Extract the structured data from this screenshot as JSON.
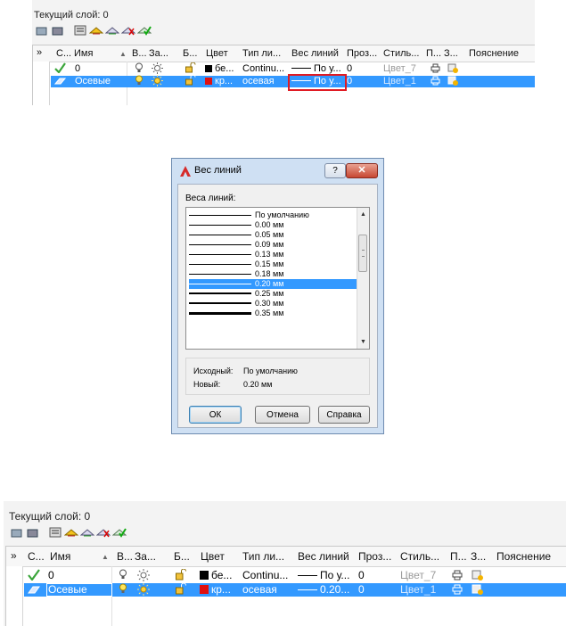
{
  "panel_before": {
    "current_layer": "Текущий слой: 0",
    "columns": [
      "С...",
      "Имя",
      "▲",
      "В...",
      "За...",
      "Б...",
      "Цвет",
      "Тип ли...",
      "Вес линий",
      "Проз...",
      "Стиль...",
      "П...",
      "З...",
      "Пояснение"
    ],
    "rows": [
      {
        "name": "0",
        "color": "бе...",
        "linetype": "Continu...",
        "lineweight": "По у...",
        "transparency": "0",
        "style": "Цвет_7",
        "swatch": "#000000",
        "selected": false
      },
      {
        "name": "Осевые",
        "color": "кр...",
        "linetype": "осевая",
        "lineweight": "По у...",
        "transparency": "0",
        "style": "Цвет_1",
        "swatch": "#e01010",
        "selected": true
      }
    ]
  },
  "dialog": {
    "title": "Вес линий",
    "help_glyph": "?",
    "close_glyph": "✕",
    "list_label": "Веса линий:",
    "items": [
      "По умолчанию",
      "0.00 мм",
      "0.05 мм",
      "0.09 мм",
      "0.13 мм",
      "0.15 мм",
      "0.18 мм",
      "0.20 мм",
      "0.25 мм",
      "0.30 мм",
      "0.35 мм"
    ],
    "selected_item": "0.20 мм",
    "original_label": "Исходный:",
    "original_value": "По умолчанию",
    "new_label": "Новый:",
    "new_value": "0.20 мм",
    "ok": "ОК",
    "cancel": "Отмена",
    "help": "Справка"
  },
  "panel_after": {
    "current_layer": "Текущий слой: 0",
    "columns": [
      "С...",
      "Имя",
      "▲",
      "В...",
      "За...",
      "Б...",
      "Цвет",
      "Тип ли...",
      "Вес линий",
      "Проз...",
      "Стиль...",
      "П...",
      "З...",
      "Пояснение"
    ],
    "rows": [
      {
        "name": "0",
        "color": "бе...",
        "linetype": "Continu...",
        "lineweight": "По у...",
        "transparency": "0",
        "style": "Цвет_7",
        "swatch": "#000000",
        "selected": false
      },
      {
        "name": "Осевые",
        "color": "кр...",
        "linetype": "осевая",
        "lineweight": "0.20...",
        "transparency": "0",
        "style": "Цвет_1",
        "swatch": "#e01010",
        "selected": true
      }
    ]
  },
  "colors": {
    "selection": "#3399ff",
    "highlight": "#e01b24",
    "check": "#3aa53a"
  },
  "icons": [
    "new-layer-icon",
    "delete-layer-icon",
    "layer-states-icon",
    "freeze-icon",
    "lock-icon",
    "unlock-icon",
    "current-check-icon",
    "lightbulb-icon",
    "sun-icon",
    "padlock-open-icon",
    "printer-icon",
    "new-vp-freeze-icon",
    "autocad-logo-icon"
  ]
}
